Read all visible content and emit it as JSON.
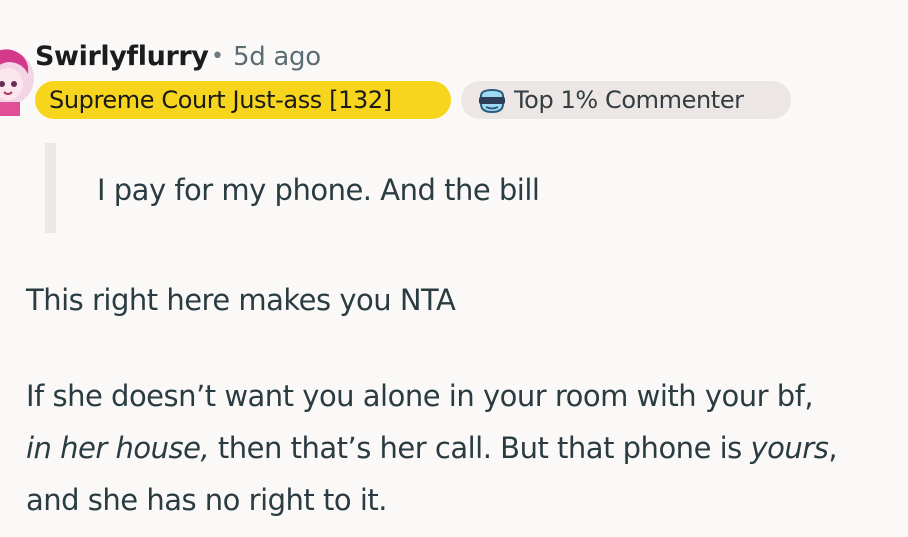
{
  "comment": {
    "author": "Swirlyflurry",
    "separator": "•",
    "timestamp": "5d ago",
    "flair": "Supreme Court Just-ass [132]",
    "badge": {
      "label": "Top 1% Commenter",
      "icon": "sunglasses-icon"
    },
    "quote": "I pay for my phone. And the bill",
    "paragraph1": "This right here makes you NTA",
    "paragraph2": {
      "line1": "If she doesn’t want you alone in your room with your bf,",
      "line2_italic": "in her house,",
      "line2_mid": " then that’s her call. But that phone is ",
      "line2_italic_end": "yours",
      "line2_end": ",",
      "line3": "and she has no right to it."
    }
  },
  "colors": {
    "background": "#fbf9f8",
    "flair_yellow": "#f7d51d",
    "badge_grey": "#ece7e5",
    "text": "#2a3c42",
    "quote_bar": "#ece8e6"
  }
}
